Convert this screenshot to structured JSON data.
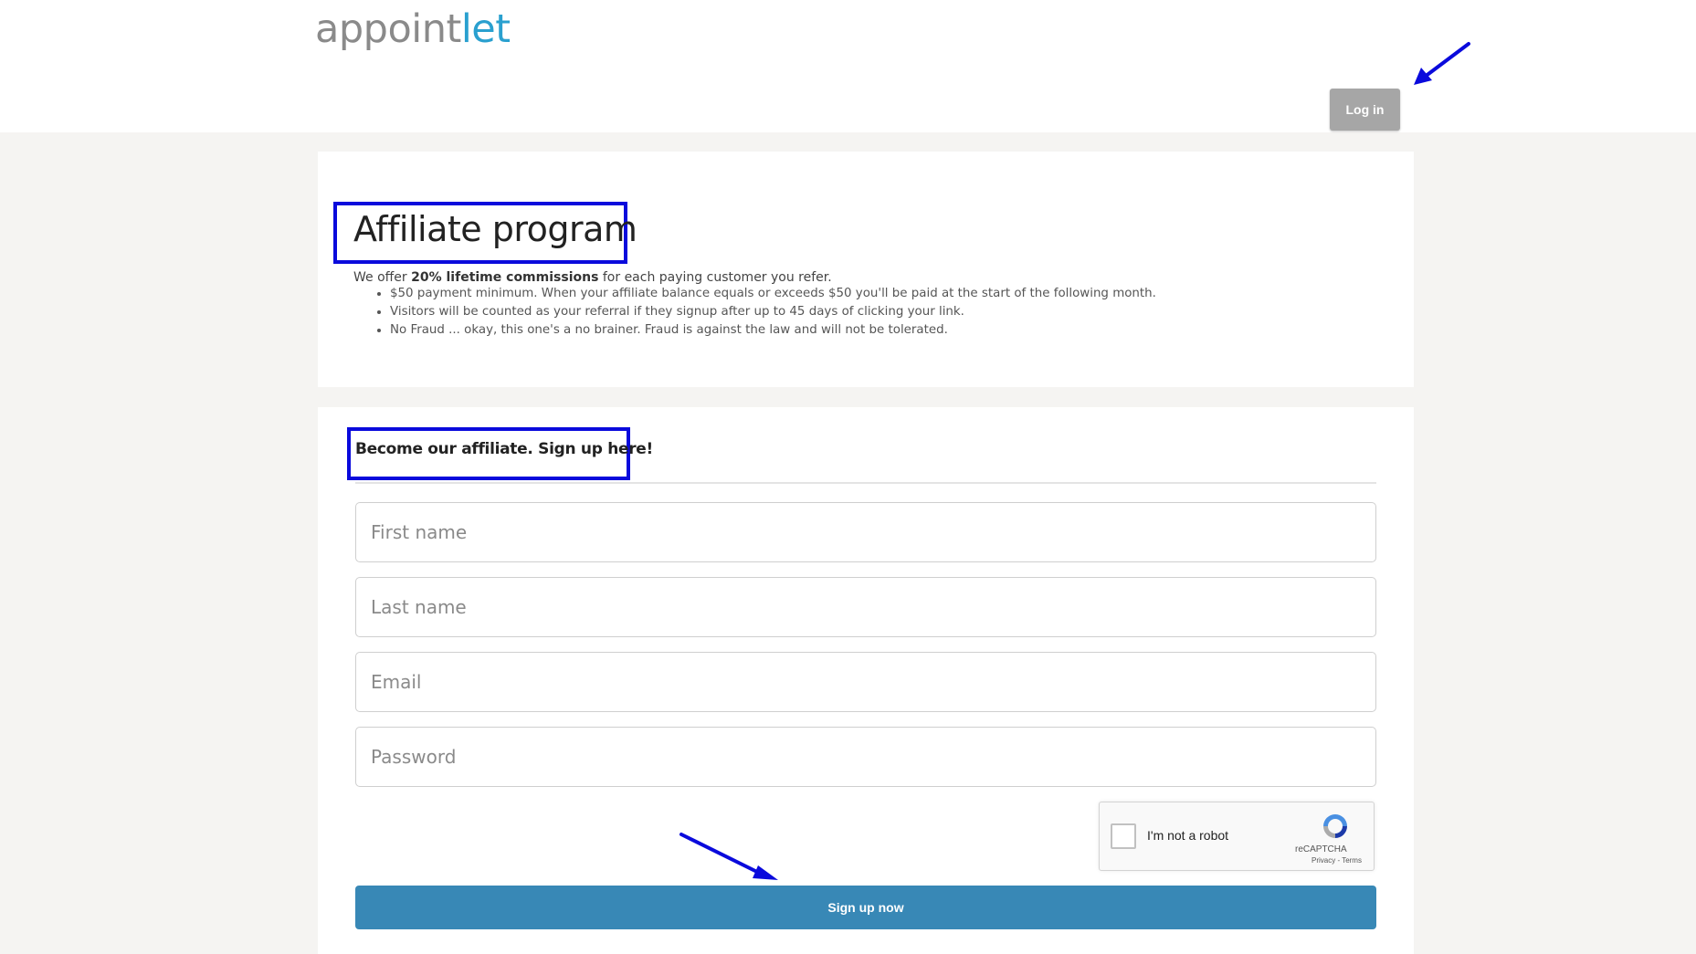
{
  "header": {
    "logo_part1": "appoint",
    "logo_part2": "let",
    "login_label": "Log in"
  },
  "intro_card": {
    "title": "Affiliate program",
    "intro_prefix": "We offer ",
    "intro_bold": "20% lifetime commissions",
    "intro_suffix": " for each paying customer you refer.",
    "rules": [
      "$50 payment minimum. When your affiliate balance equals or exceeds $50 you'll be paid at the start of the following month.",
      "Visitors will be counted as your referral if they signup after up to 45 days of clicking your link.",
      "No Fraud ... okay, this one's a no brainer. Fraud is against the law and will not be tolerated."
    ]
  },
  "signup_form": {
    "title": "Become our affiliate. Sign up here!",
    "first_name_placeholder": "First name",
    "last_name_placeholder": "Last name",
    "email_placeholder": "Email",
    "password_placeholder": "Password",
    "recaptcha": {
      "label": "I'm not a robot",
      "brand": "reCAPTCHA",
      "links": "Privacy - Terms"
    },
    "submit_label": "Sign up now"
  },
  "colors": {
    "logo_accent": "#2aa0cf",
    "signup_button": "#3888b6",
    "login_button": "#a6a6a6",
    "annotation": "#0a0adc"
  }
}
